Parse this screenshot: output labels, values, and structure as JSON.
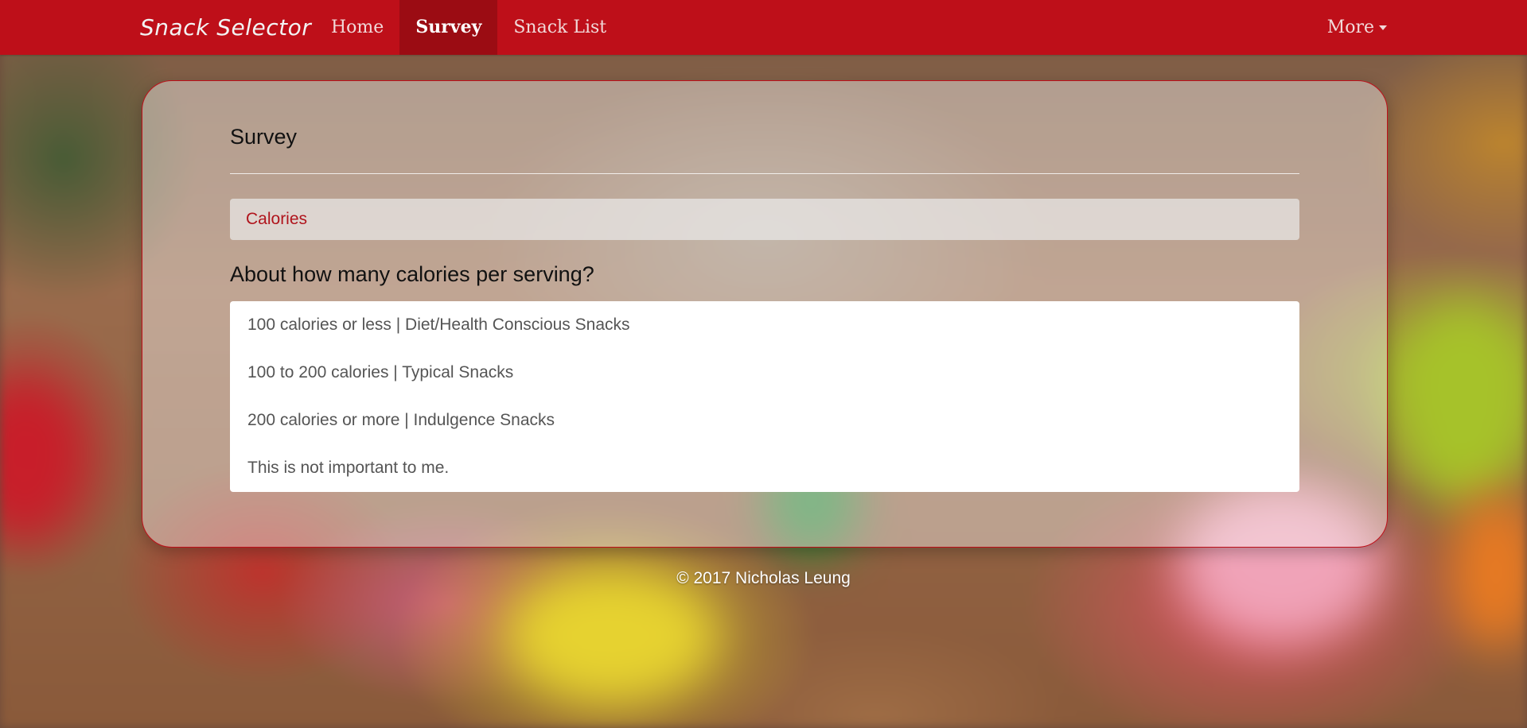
{
  "navbar": {
    "brand": "Snack Selector",
    "links": [
      {
        "label": "Home",
        "active": false
      },
      {
        "label": "Survey",
        "active": true
      },
      {
        "label": "Snack List",
        "active": false
      }
    ],
    "more_label": "More",
    "color": "#be0f19",
    "active_color": "#9b0c13"
  },
  "survey": {
    "title": "Survey",
    "breadcrumb": "Calories",
    "question": "About how many calories per serving?",
    "options": [
      "100 calories or less | Diet/Health Conscious Snacks",
      "100 to 200 calories | Typical Snacks",
      "200 calories or more | Indulgence Snacks",
      "This is not important to me."
    ]
  },
  "footer": {
    "text": "© 2017 Nicholas Leung"
  }
}
